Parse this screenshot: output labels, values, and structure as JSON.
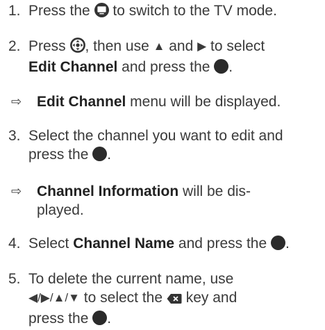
{
  "steps": [
    {
      "num": "1.",
      "t1": "Press the ",
      "icon1": "tv-source-icon",
      "t2": " to switch to the TV mode."
    },
    {
      "num": "2.",
      "t1": "Press ",
      "icon1": "dpad-icon",
      "t2": ", then use ",
      "sym_up": "▲",
      "t3": " and ",
      "sym_right": "▶",
      "t4": " to select",
      "bold": "Edit Channel",
      "t5": " and press the ",
      "icon2": "ok-button-icon",
      "t6": "."
    },
    {
      "num": "3.",
      "line1": "Select the channel you want to edit and",
      "t1": "press the ",
      "icon1": "ok-button-icon",
      "t2": "."
    },
    {
      "num": "4.",
      "t1": "Select ",
      "bold": "Channel Name",
      "t2": " and press the ",
      "icon1": "ok-button-icon",
      "t3": "."
    },
    {
      "num": "5.",
      "line1": "To delete the current name, use",
      "arrows": "◀/▶/▲/▼",
      "t1": " to select the ",
      "icon1": "delete-key-icon",
      "t2": " key and",
      "t3": "press the ",
      "icon2": "ok-button-icon",
      "t4": "."
    }
  ],
  "results": [
    {
      "arrow": "⇨",
      "bold": "Edit Channel",
      "text": " menu will be displayed."
    },
    {
      "arrow": "⇨",
      "bold": "Channel Information",
      "text": " will be dis-",
      "text2": "played."
    }
  ]
}
